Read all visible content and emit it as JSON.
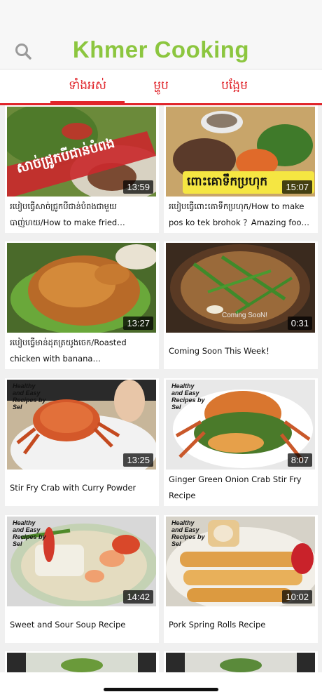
{
  "header": {
    "title": "Khmer Cooking",
    "search_icon": "search-icon"
  },
  "tabs": [
    {
      "label": "ទាំងអស់",
      "active": true
    },
    {
      "label": "ម្ហូប",
      "active": false
    },
    {
      "label": "បង្អែម",
      "active": false
    }
  ],
  "videos": [
    {
      "caption": "របៀបធ្វើសាច់ជ្រូកបីជាន់បំពងជាមួយបាញ់ហយ/How to make fried pork/Amazing food and popular",
      "duration": "13:59",
      "overlay_text": "សាច់ជ្រូកបីជាន់បំពង"
    },
    {
      "caption": "របៀបធ្វើពោះគោទឹកប្រហុក/How to make pos ko tek brohok ？Amazing food and popular",
      "duration": "15:07",
      "overlay_text": "ពោះគោទឹកប្រហុក"
    },
    {
      "caption": "របៀបធ្វើមាន់ដុតត្រយូងចេក/Roasted chicken with banana flower/Amazing food/ Asian food",
      "duration": "13:27"
    },
    {
      "caption": "Coming Soon This Week！",
      "duration": "0:31",
      "overlay_text": "Coming SooN!"
    },
    {
      "caption": "Stir Fry Crab with Curry Powder",
      "duration": "13:25",
      "overlay_text": "Healthy and Easy Recipes by Sel"
    },
    {
      "caption": "Ginger Green Onion Crab Stir Fry Recipe",
      "duration": "8:07",
      "overlay_text": "Healthy and Easy Recipes by Sel"
    },
    {
      "caption": "Sweet and Sour Soup Recipe",
      "duration": "14:42",
      "overlay_text": "Healthy and Easy Recipes by Sel"
    },
    {
      "caption": "Pork Spring Rolls Recipe",
      "duration": "10:02",
      "overlay_text": "Healthy and Easy Recipes by Sel"
    }
  ],
  "colors": {
    "brand_green": "#8cc63f",
    "tab_red": "#e0242a"
  }
}
